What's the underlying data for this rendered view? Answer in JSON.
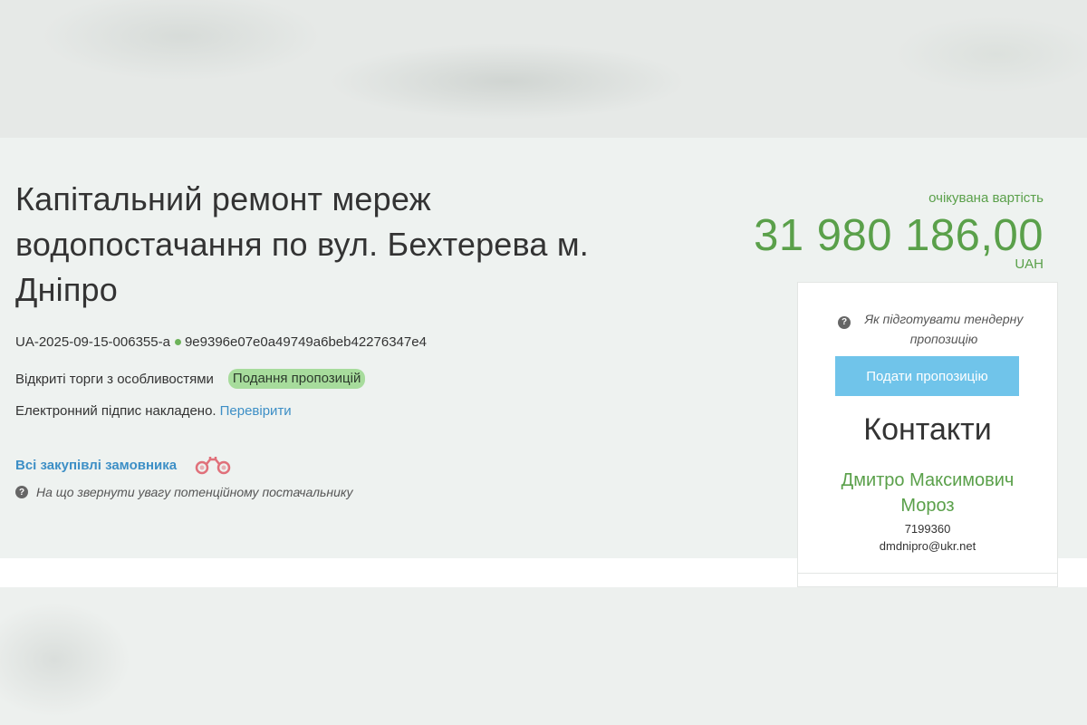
{
  "tender": {
    "title": "Капітальний ремонт мереж водопостачання по вул. Бехтерева м. Дніпро",
    "tender_id": "UA-2025-09-15-006355-a",
    "hash": "9e9396e07e0a49749a6beb42276347e4",
    "procedure": "Відкриті торги з особливостями",
    "status": "Подання пропозицій",
    "signature_text": "Електронний підпис накладено.",
    "signature_check_link": "Перевірити",
    "buyer_link": "Всі закупівлі замовника",
    "supplier_hint": "На що звернути увагу потенційному постачальнику"
  },
  "price": {
    "label": "очікувана вартість",
    "amount": "31 980 186,00",
    "currency": "UAH"
  },
  "panel": {
    "hint": "Як підготувати тендерну пропозицію",
    "submit_label": "Подати пропозицію",
    "contacts_title": "Контакти",
    "contact_name": "Дмитро Максимович Мороз",
    "contact_phone": "7199360",
    "contact_email": "dmdnipro@ukr.net"
  },
  "icons": {
    "question": "question-circle-icon",
    "binoculars": "binoculars-icon"
  },
  "colors": {
    "accent_green": "#5aa04a",
    "link_blue": "#3d8fc6",
    "button_blue": "#70c4ea",
    "status_badge": "#a7dc9c",
    "binoculars": "#e0707a"
  }
}
